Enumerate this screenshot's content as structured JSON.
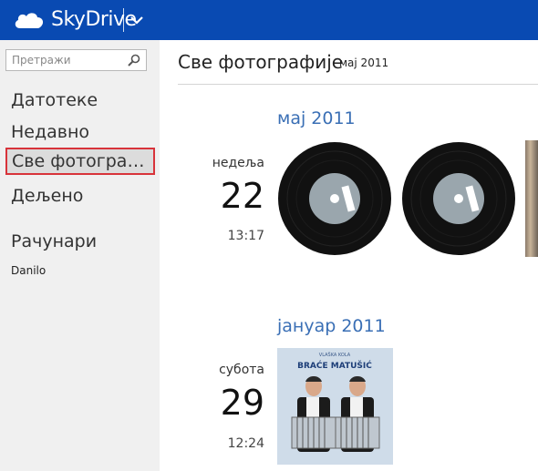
{
  "header": {
    "brand": "SkyDrive",
    "logo_icon": "cloud-icon",
    "menu_icon": "chevron-down-icon",
    "bar_color": "#094ab2"
  },
  "sidebar": {
    "search_placeholder": "Претражи",
    "items": [
      {
        "label": "Датотеке"
      },
      {
        "label": "Недавно"
      },
      {
        "label": "Све фотографије",
        "active": true
      },
      {
        "label": "Дељено"
      }
    ],
    "section_title": "Рачунари",
    "computers": [
      {
        "label": "Danilo"
      }
    ]
  },
  "main": {
    "title": "Све фотографије",
    "subtitle": "мај 2011",
    "groups": [
      {
        "month": "мај 2011",
        "day_name": "недеља",
        "day_number": "22",
        "time": "13:17",
        "photos": [
          "vinyl-record",
          "vinyl-record",
          "photo-partial"
        ]
      },
      {
        "month": "јануар 2011",
        "day_name": "субота",
        "day_number": "29",
        "time": "12:24",
        "photos": [
          "album-cover"
        ],
        "album_cover": {
          "top_text": "VLAŠKA KOLA",
          "title": "BRAĆE MATUŠIĆ"
        }
      }
    ]
  },
  "colors": {
    "accent": "#094ab2",
    "link": "#3a6fb5",
    "highlight_border": "#d8333a"
  }
}
